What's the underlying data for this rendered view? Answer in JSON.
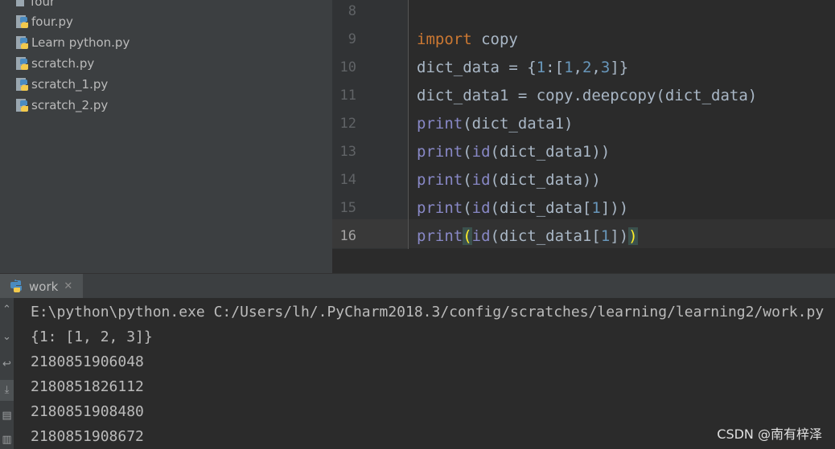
{
  "project": {
    "items": [
      {
        "label": "four",
        "icon": "folder-file-icon"
      },
      {
        "label": "four.py",
        "icon": "python-file-icon"
      },
      {
        "label": "Learn python.py",
        "icon": "python-file-icon"
      },
      {
        "label": "scratch.py",
        "icon": "python-file-icon"
      },
      {
        "label": "scratch_1.py",
        "icon": "python-file-icon"
      },
      {
        "label": "scratch_2.py",
        "icon": "python-file-icon"
      }
    ]
  },
  "editor": {
    "line_numbers": [
      "8",
      "9",
      "10",
      "11",
      "12",
      "13",
      "14",
      "15",
      "16"
    ],
    "current_line": "16"
  },
  "run": {
    "tab_label": "work",
    "console": [
      "E:\\python\\python.exe C:/Users/lh/.PyCharm2018.3/config/scratches/learning/learning2/work.py",
      "{1: [1, 2, 3]}",
      "2180851906048",
      "2180851826112",
      "2180851908480",
      "2180851908672"
    ]
  },
  "watermark": "CSDN @南有梓泽",
  "colors": {
    "keyword": "#cc7832",
    "builtin": "#8888c6",
    "number": "#6897bb",
    "text": "#a9b7c6"
  }
}
